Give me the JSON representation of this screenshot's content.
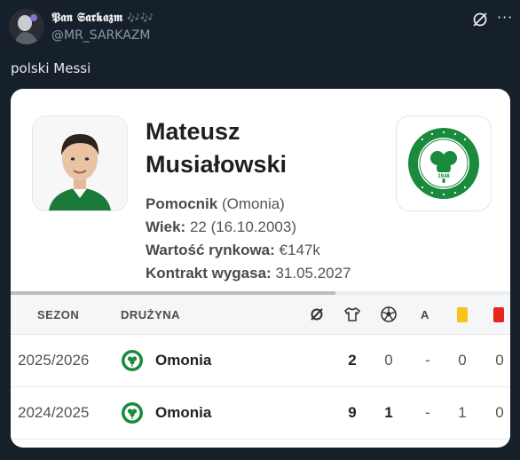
{
  "tweet": {
    "display_name": "𝕻𝖆𝖓 𝕾𝖆𝖗𝖐𝖆𝖟𝖒",
    "emojis": "🎶🎶",
    "handle": "@MR_SARKAZM",
    "text": "polski Messi"
  },
  "card": {
    "player": {
      "first_name": "Mateusz",
      "last_name": "Musiałowski",
      "position_label": "Pomocnik",
      "club_paren": "(Omonia)",
      "age_label": "Wiek:",
      "age_value": "22 (16.10.2003)",
      "value_label": "Wartość rynkowa:",
      "value_value": "€147k",
      "contract_label": "Kontrakt wygasa:",
      "contract_value": "31.05.2027"
    },
    "scroll_progress": 0.65,
    "table": {
      "headers": {
        "season": "SEZON",
        "team": "DRUŻYNA",
        "matches_icon": "average-icon",
        "apps_icon": "shirt-icon",
        "goals_icon": "ball-icon",
        "assists": "A",
        "yellow_icon": "yellow-card-icon",
        "red_icon": "red-card-icon"
      },
      "rows": [
        {
          "season": "2025/2026",
          "team": "Omonia",
          "apps": "2",
          "goals": "0",
          "assists": "-",
          "yellow": "0",
          "red": "0"
        },
        {
          "season": "2024/2025",
          "team": "Omonia",
          "apps": "9",
          "goals": "1",
          "assists": "-",
          "yellow": "1",
          "red": "0"
        }
      ]
    },
    "colors": {
      "omonia_green": "#1a8a3c",
      "yellow_card": "#f5c518",
      "red_card": "#e8251f"
    }
  }
}
